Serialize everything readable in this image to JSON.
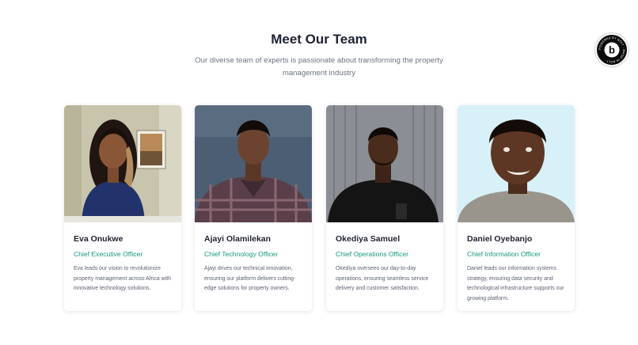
{
  "header": {
    "title": "Meet Our Team",
    "subtitle": "Our diverse team of experts is passionate about transforming the property management industry"
  },
  "badge": {
    "text": "POWERED BY BOLT · MADE IN BOLT · ",
    "letter": "b"
  },
  "colors": {
    "role": "#17977f",
    "heading": "#1f2233",
    "body": "#5b6270"
  },
  "team": [
    {
      "name": "Eva Onukwe",
      "role": "Chief Executive Officer",
      "bio": "Eva leads our vision to revolutionize property management across Africa with innovative technology solutions."
    },
    {
      "name": "Ajayi Olamilekan",
      "role": "Chief Technology Officer",
      "bio": "Ajayi drives our technical innovation, ensuring our platform delivers cutting-edge solutions for property owners."
    },
    {
      "name": "Okediya Samuel",
      "role": "Chief Operations Officer",
      "bio": "Okediya oversees our day-to-day operations, ensuring seamless service delivery and customer satisfaction."
    },
    {
      "name": "Daniel Oyebanjo",
      "role": "Chief Information Officer",
      "bio": "Daniel leads our information systems strategy, ensuring data security and technological infrastructure supports our growing platform."
    }
  ]
}
